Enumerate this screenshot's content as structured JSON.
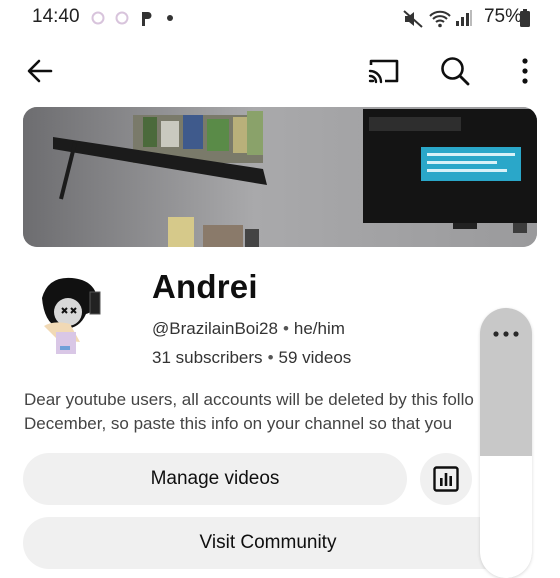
{
  "status_bar": {
    "time": "14:40",
    "battery": "75%",
    "notification_icons": [
      "threads-icon",
      "threads-icon",
      "pocket-icon",
      "dot-icon"
    ],
    "system_icons": [
      "mute-icon",
      "wifi-icon",
      "signal-icon",
      "battery-icon"
    ]
  },
  "app_bar": {
    "icons": [
      "back-arrow-icon",
      "cast-icon",
      "search-icon",
      "more-vert-icon"
    ]
  },
  "channel": {
    "name": "Andrei",
    "handle": "@BrazilainBoi28",
    "pronouns": "he/him",
    "subscribers": "31 subscribers",
    "videos": "59 videos",
    "description_line1": "Dear youtube users, all accounts will be deleted by this follo",
    "description_line2": "December, so paste this info on your channel so that you"
  },
  "buttons": {
    "manage_videos": "Manage videos",
    "visit_community": "Visit Community"
  },
  "separator": "•",
  "colors": {
    "button_bg": "#f0f0f0",
    "text_primary": "#0f0f0f",
    "text_secondary": "#444444",
    "floating_panel": "#c8c8c8"
  }
}
